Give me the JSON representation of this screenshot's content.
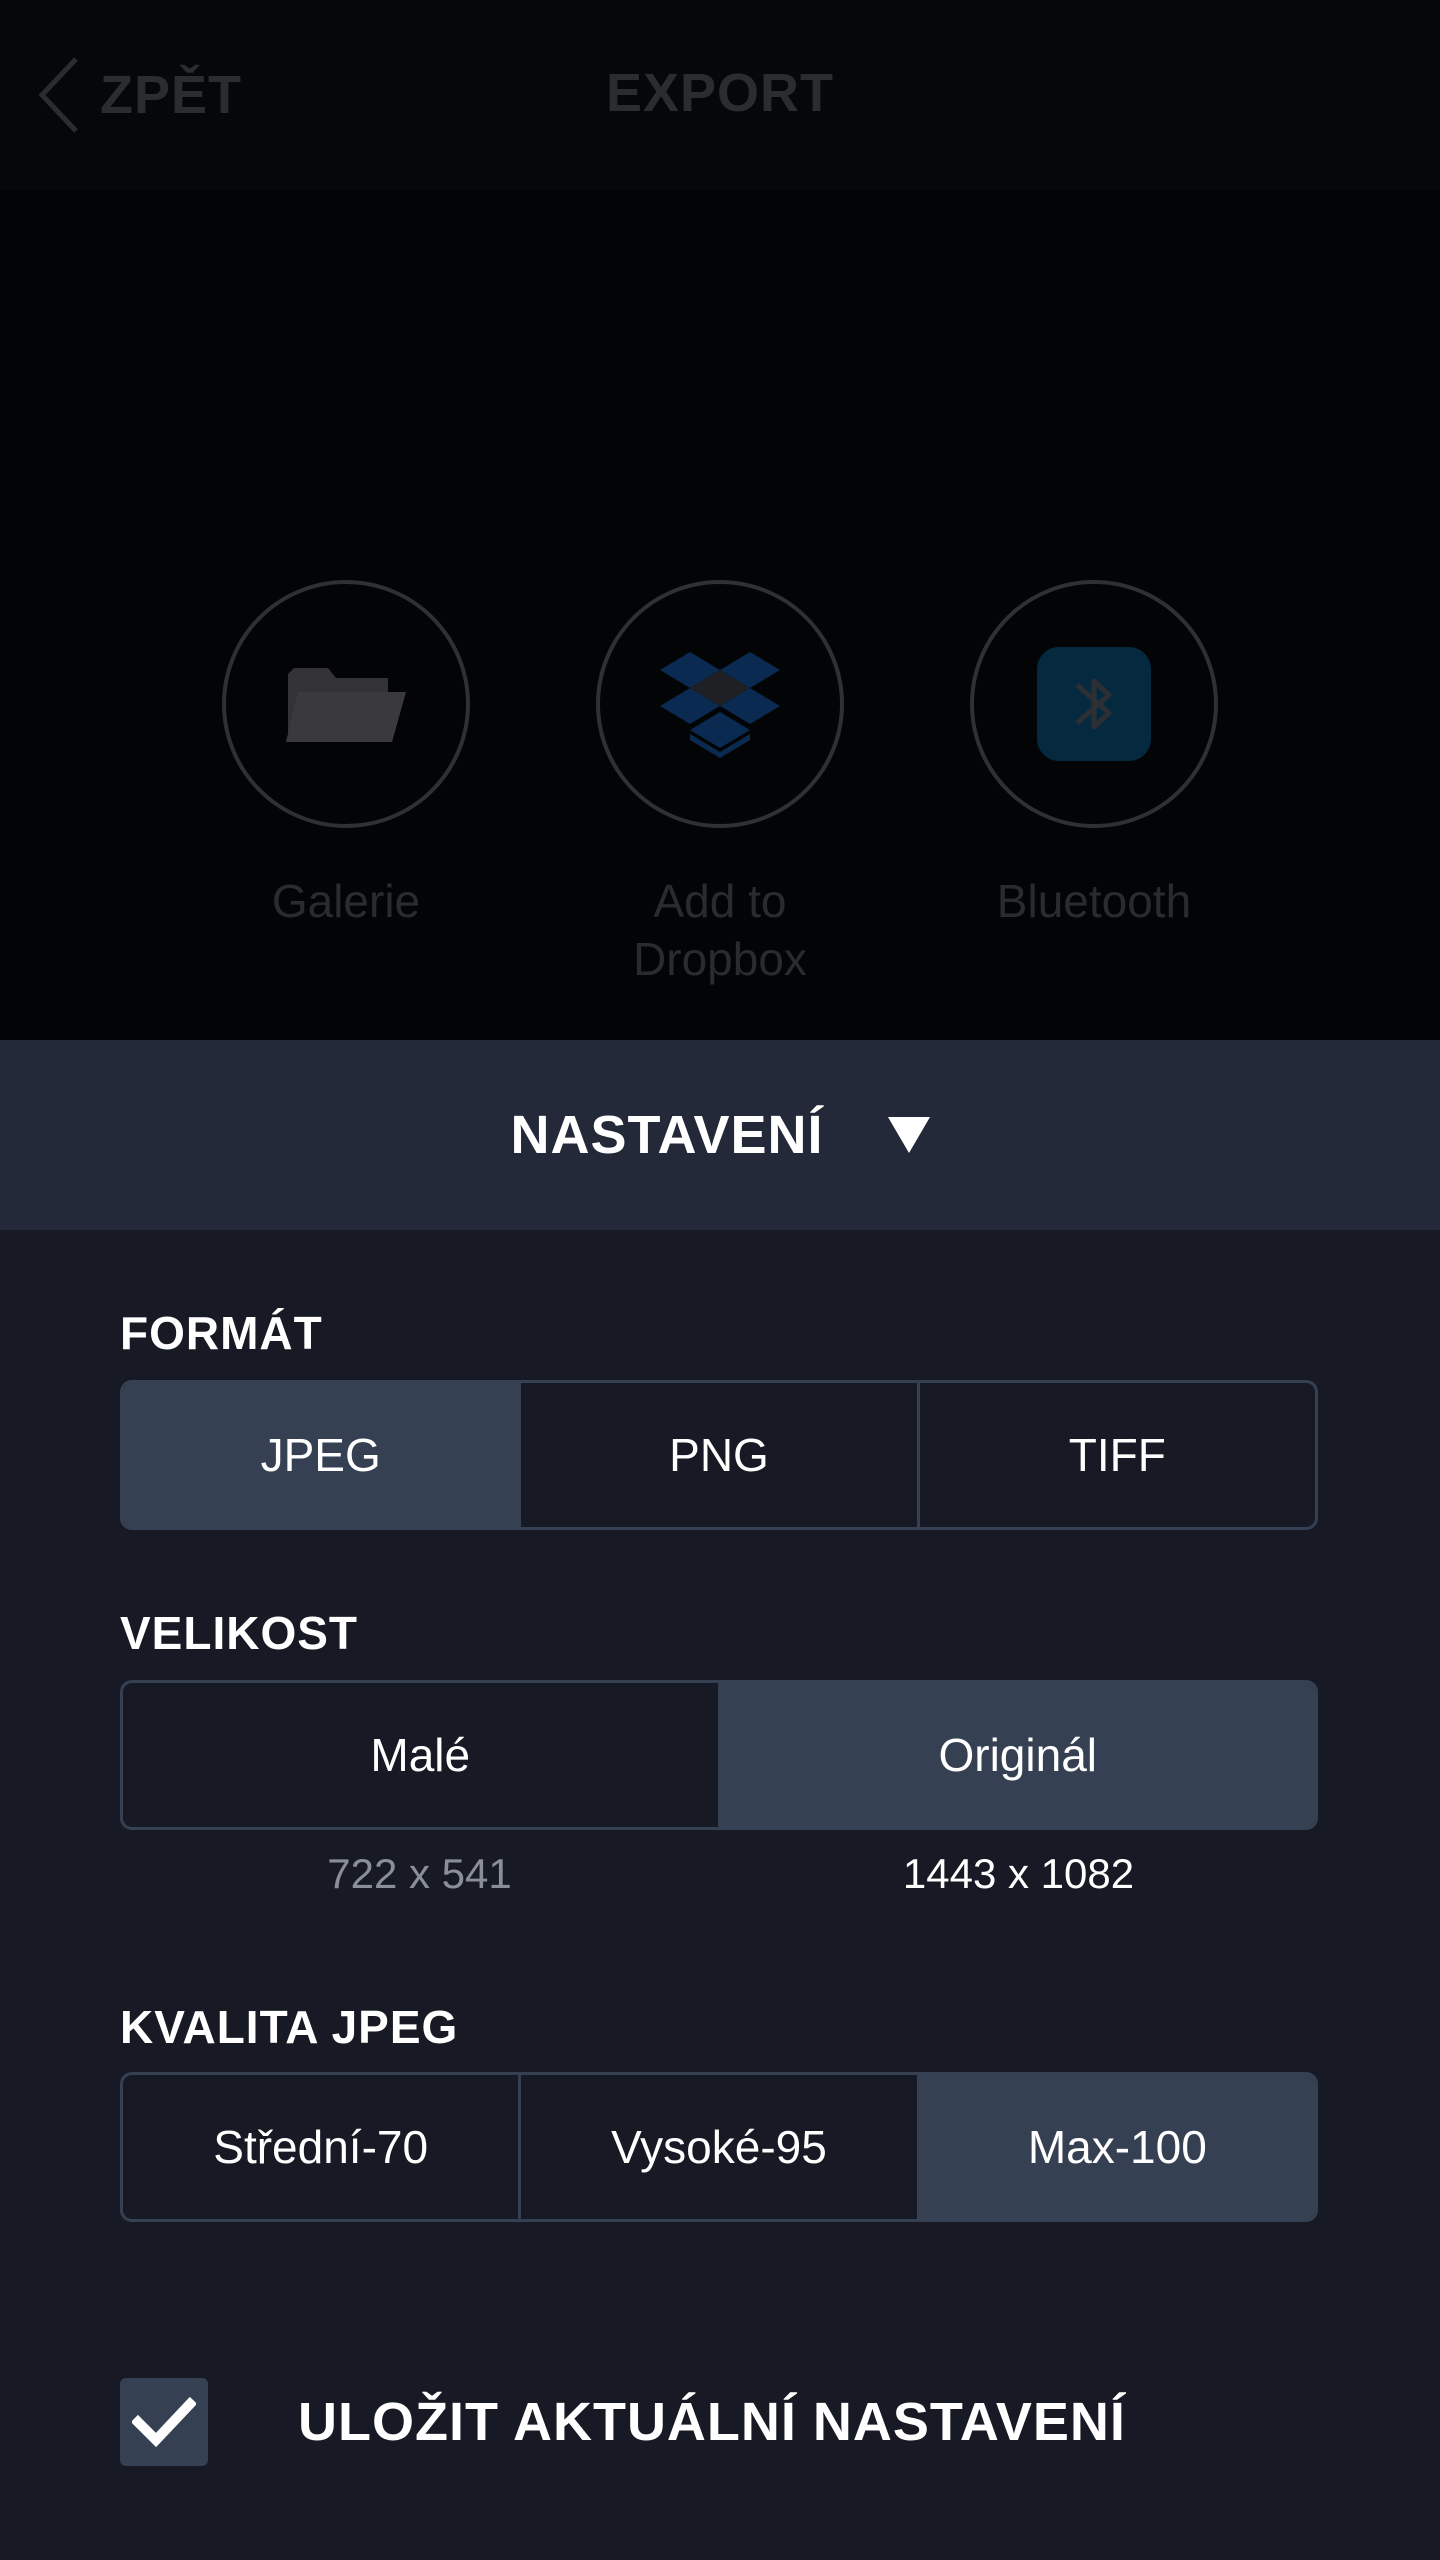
{
  "header": {
    "back_label": "ZPĚT",
    "title": "EXPORT"
  },
  "share_targets": [
    {
      "label": "Galerie",
      "icon": "folder-icon"
    },
    {
      "label": "Add to\nDropbox",
      "icon": "dropbox-icon"
    },
    {
      "label": "Bluetooth",
      "icon": "bluetooth-icon"
    }
  ],
  "settings": {
    "title": "NASTAVENÍ",
    "format": {
      "label": "FORMÁT",
      "options": [
        "JPEG",
        "PNG",
        "TIFF"
      ],
      "selected": "JPEG"
    },
    "size": {
      "label": "VELIKOST",
      "options": [
        "Malé",
        "Originál"
      ],
      "dimensions": [
        "722 x 541",
        "1443 x 1082"
      ],
      "selected": "Originál"
    },
    "quality": {
      "label": "KVALITA JPEG",
      "options": [
        "Střední-70",
        "Vysoké-95",
        "Max-100"
      ],
      "selected": "Max-100"
    },
    "save_current": {
      "label": "ULOŽIT AKTUÁLNÍ NASTAVENÍ",
      "checked": true
    }
  },
  "colors": {
    "sheet_bg": "#171a24",
    "header_bg": "#232938",
    "selected_segment": "#364053",
    "dropbox_blue": "#0a2a52",
    "bluetooth_blue": "#052a40"
  }
}
